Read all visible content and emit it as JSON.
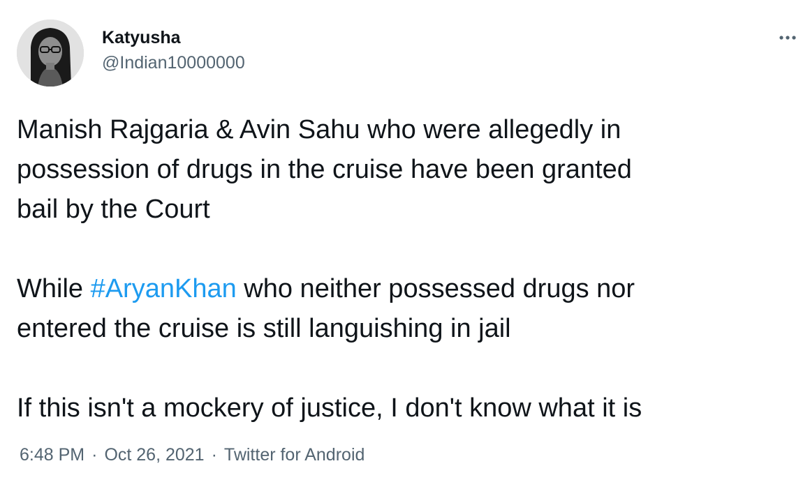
{
  "user": {
    "display_name": "Katyusha",
    "handle": "@Indian10000000"
  },
  "icons": {
    "more": "more-horizontal-icon",
    "avatar": "user-avatar-photo"
  },
  "colors": {
    "text": "#0f1419",
    "secondary": "#536471",
    "link": "#1d9bf0"
  },
  "tweet": {
    "paragraph1": {
      "line1": "Manish Rajgaria & Avin Sahu who were allegedly in",
      "line2": "possession of drugs in the cruise have been granted",
      "line3": "bail by the Court"
    },
    "paragraph2": {
      "prefix": "While ",
      "hashtag": "#AryanKhan",
      "line1_rest": " who neither possessed drugs nor",
      "line2": "entered the cruise is still languishing in jail"
    },
    "paragraph3": {
      "line1": "If this isn't a mockery of justice, I don't know what it is"
    }
  },
  "meta": {
    "time": "6:48 PM",
    "separator": "·",
    "date": "Oct 26, 2021",
    "source": "Twitter for Android"
  }
}
